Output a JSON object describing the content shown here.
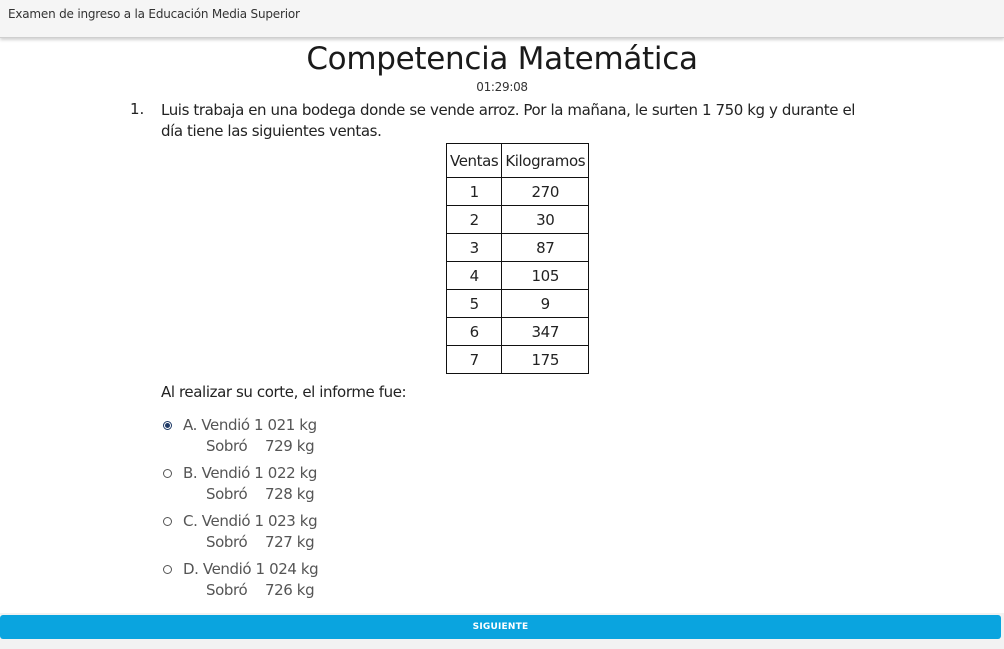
{
  "header": {
    "app_title": "Examen de ingreso a la Educación Media Superior"
  },
  "page": {
    "title": "Competencia Matemática",
    "timer": "01:29:08"
  },
  "question": {
    "number": "1.",
    "text": "Luis trabaja en una bodega donde se vende arroz. Por la mañana, le surten 1 750 kg y durante el día tiene las siguientes ventas.",
    "table": {
      "headers": [
        "Ventas",
        "Kilogramos"
      ],
      "rows": [
        [
          "1",
          "270"
        ],
        [
          "2",
          "30"
        ],
        [
          "3",
          "87"
        ],
        [
          "4",
          "105"
        ],
        [
          "5",
          "9"
        ],
        [
          "6",
          "347"
        ],
        [
          "7",
          "175"
        ]
      ]
    },
    "report_text": "Al realizar su corte, el informe fue:",
    "options": [
      {
        "line1": "A. Vendió 1 021 kg",
        "rest_label": "Sobró",
        "rest_value": "729 kg",
        "selected": true
      },
      {
        "line1": "B. Vendió 1 022 kg",
        "rest_label": "Sobró",
        "rest_value": "728 kg",
        "selected": false
      },
      {
        "line1": "C. Vendió 1 023 kg",
        "rest_label": "Sobró",
        "rest_value": "727 kg",
        "selected": false
      },
      {
        "line1": "D. Vendió 1 024 kg",
        "rest_label": "Sobró",
        "rest_value": "726 kg",
        "selected": false
      }
    ]
  },
  "footer": {
    "next_label": "SIGUIENTE"
  },
  "colors": {
    "accent": "#0aa4df",
    "radio_selected": "#1f3a66"
  }
}
